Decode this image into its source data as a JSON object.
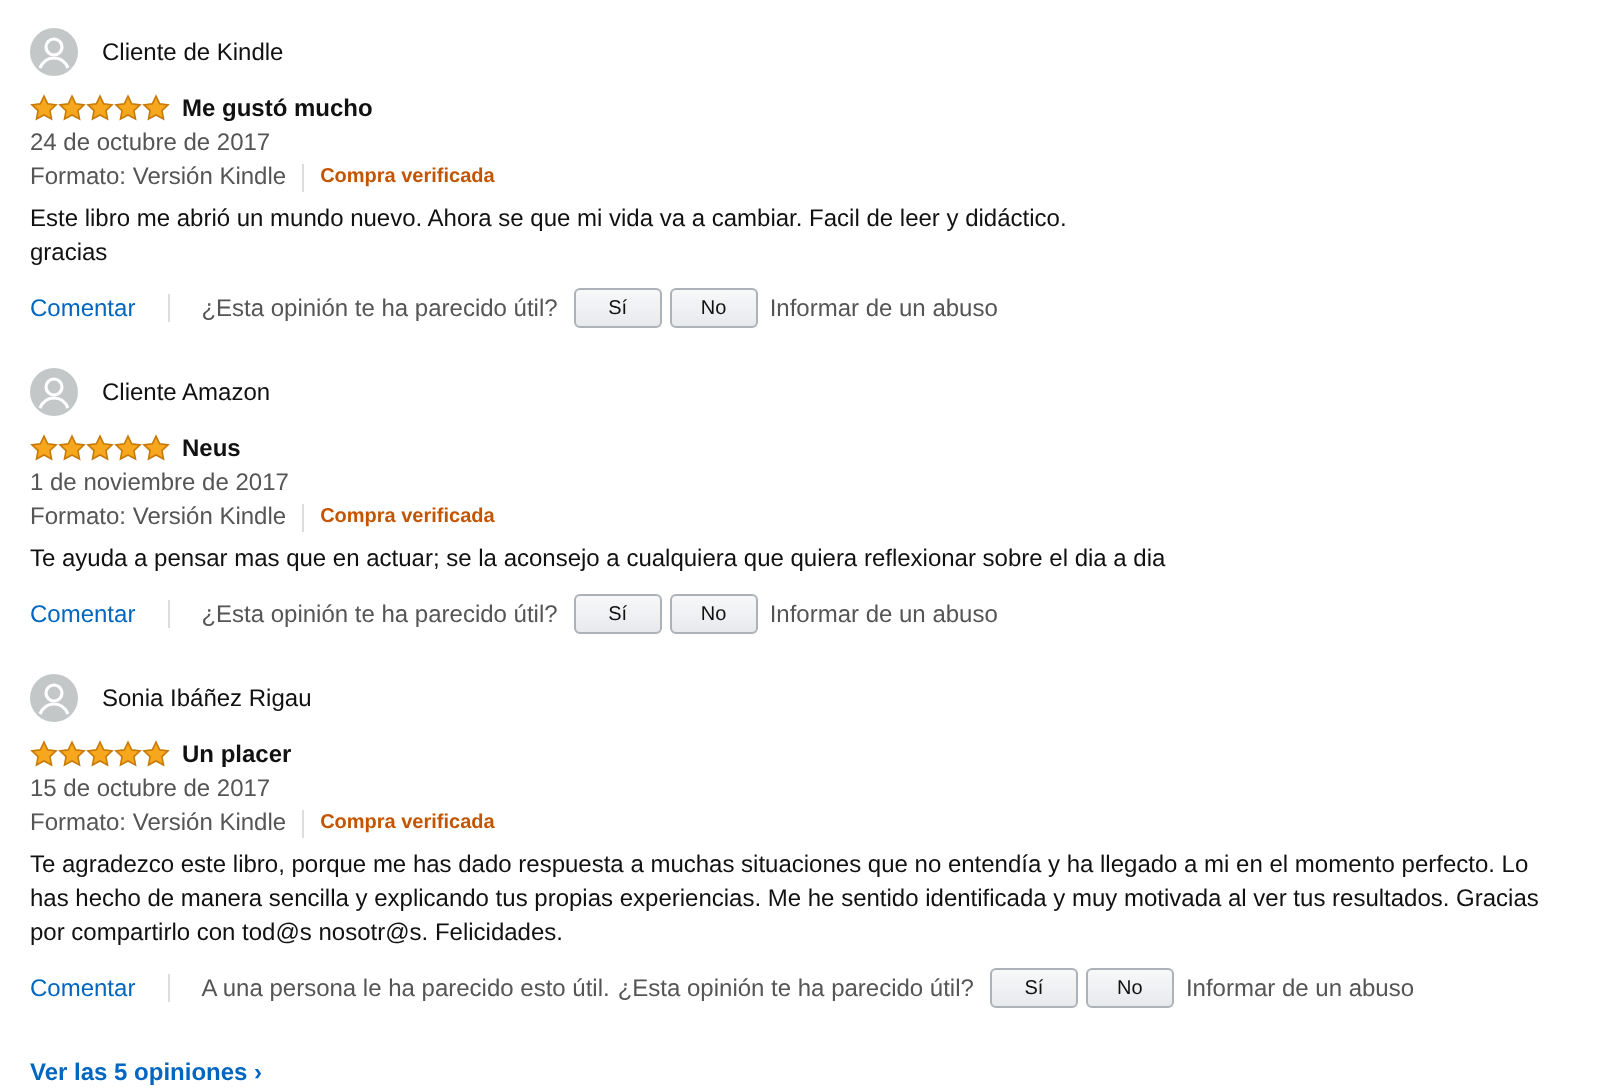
{
  "reviews": [
    {
      "author": "Cliente de Kindle",
      "stars": 5,
      "title": "Me gustó mucho",
      "date": "24 de octubre de 2017",
      "format": "Formato: Versión Kindle",
      "badge": "Compra verificada",
      "body": "Este libro me abrió un mundo nuevo. Ahora se que mi vida va a cambiar. Facil de leer y didáctico.\ngracias",
      "comment": "Comentar",
      "question": "¿Esta opinión te ha parecido útil?",
      "yes": "Sí",
      "no": "No",
      "report": "Informar de un abuso"
    },
    {
      "author": "Cliente Amazon",
      "stars": 5,
      "title": "Neus",
      "date": "1 de noviembre de 2017",
      "format": "Formato: Versión Kindle",
      "badge": "Compra verificada",
      "body": "Te ayuda a pensar mas que en actuar; se la aconsejo a cualquiera que quiera reflexionar sobre el dia a dia",
      "comment": "Comentar",
      "question": "¿Esta opinión te ha parecido útil?",
      "yes": "Sí",
      "no": "No",
      "report": "Informar de un abuso"
    },
    {
      "author": "Sonia Ibáñez Rigau",
      "stars": 5,
      "title": "Un placer",
      "date": "15 de octubre de 2017",
      "format": "Formato: Versión Kindle",
      "badge": "Compra verificada",
      "body": "Te agradezco este libro, porque me has dado respuesta a muchas situaciones que no entendía y ha llegado a mi en el momento perfecto. Lo has hecho de manera sencilla y explicando tus propias experiencias. Me he sentido identificada y muy motivada al ver tus resultados. Gracias por compartirlo con tod@s nosotr@s. Felicidades.",
      "comment": "Comentar",
      "helpful_note": "A una persona le ha parecido esto útil.",
      "question": "¿Esta opinión te ha parecido útil?",
      "yes": "Sí",
      "no": "No",
      "report": "Informar de un abuso"
    }
  ],
  "see_all": "Ver las 5 opiniones ›"
}
